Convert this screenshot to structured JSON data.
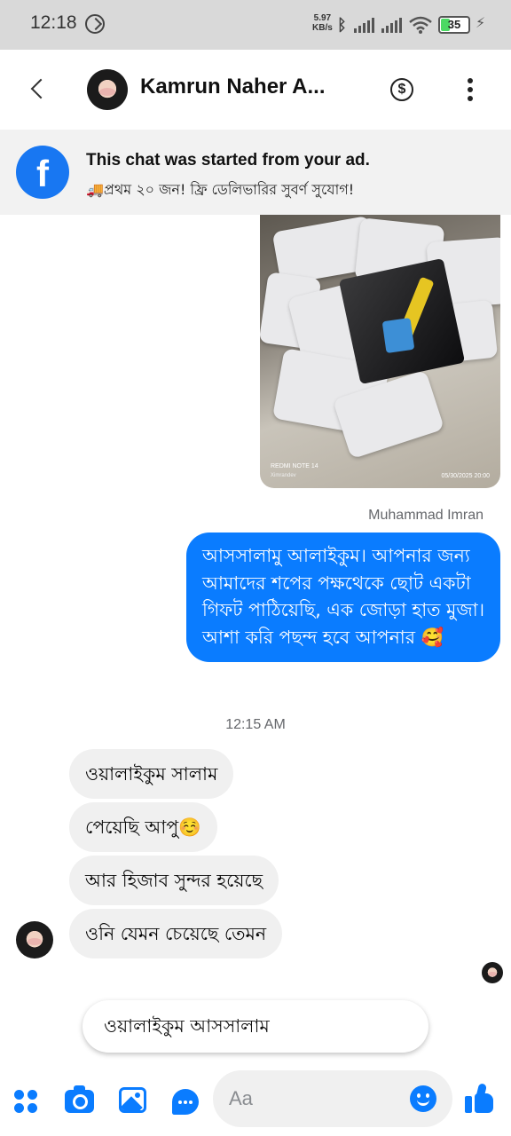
{
  "status_bar": {
    "time": "12:18",
    "speed_value": "5.97",
    "speed_unit": "KB/s",
    "battery_percent": 35,
    "battery_label": "35"
  },
  "header": {
    "contact_name": "Kamrun Naher A...",
    "payment_icon": "$"
  },
  "ad_banner": {
    "title": "This chat was started from your ad.",
    "subtitle": "🚚প্রথম ২০ জন! ফ্রি ডেলিভারির সুবর্ণ সুযোগ!",
    "logo": "f"
  },
  "photo": {
    "caption_device": "REDMI NOTE 14",
    "caption_author": "Ximrandev",
    "caption_date": "05/30/2025 20:00"
  },
  "messages": {
    "sender_name": "Muhammad Imran",
    "outgoing_text": "আসসালামু আলাইকুম। আপনার জন্য আমাদের শপের পক্ষথেকে ছোট একটা গিফট পাঠিয়েছি, এক জোড়া হাত মুজা। আশা করি পছন্দ হবে আপনার 🥰",
    "timestamp": "12:15 AM",
    "incoming": [
      "ওয়ালাইকুম সালাম",
      "পেয়েছি আপু☺️",
      "আর হিজাব সুন্দর হয়েছে",
      "ওনি যেমন চেয়েছে তেমন"
    ]
  },
  "suggestion": {
    "text": "ওয়ালাইকুম আসসালাম"
  },
  "composer": {
    "placeholder": "Aa"
  },
  "colors": {
    "messenger_blue": "#0a7cff",
    "facebook_blue": "#1877f2",
    "incoming_bubble": "#f0f0f0",
    "status_bar_bg": "#d9d9d9",
    "banner_bg": "#f2f2f2"
  },
  "icons": [
    "back-arrow-icon",
    "dollar-icon",
    "more-icon",
    "facebook-icon",
    "apps-icon",
    "camera-icon",
    "gallery-icon",
    "chat-bubble-icon",
    "emoji-icon",
    "like-icon",
    "bluetooth-icon",
    "wifi-icon",
    "signal-icon",
    "battery-icon",
    "charging-icon"
  ]
}
